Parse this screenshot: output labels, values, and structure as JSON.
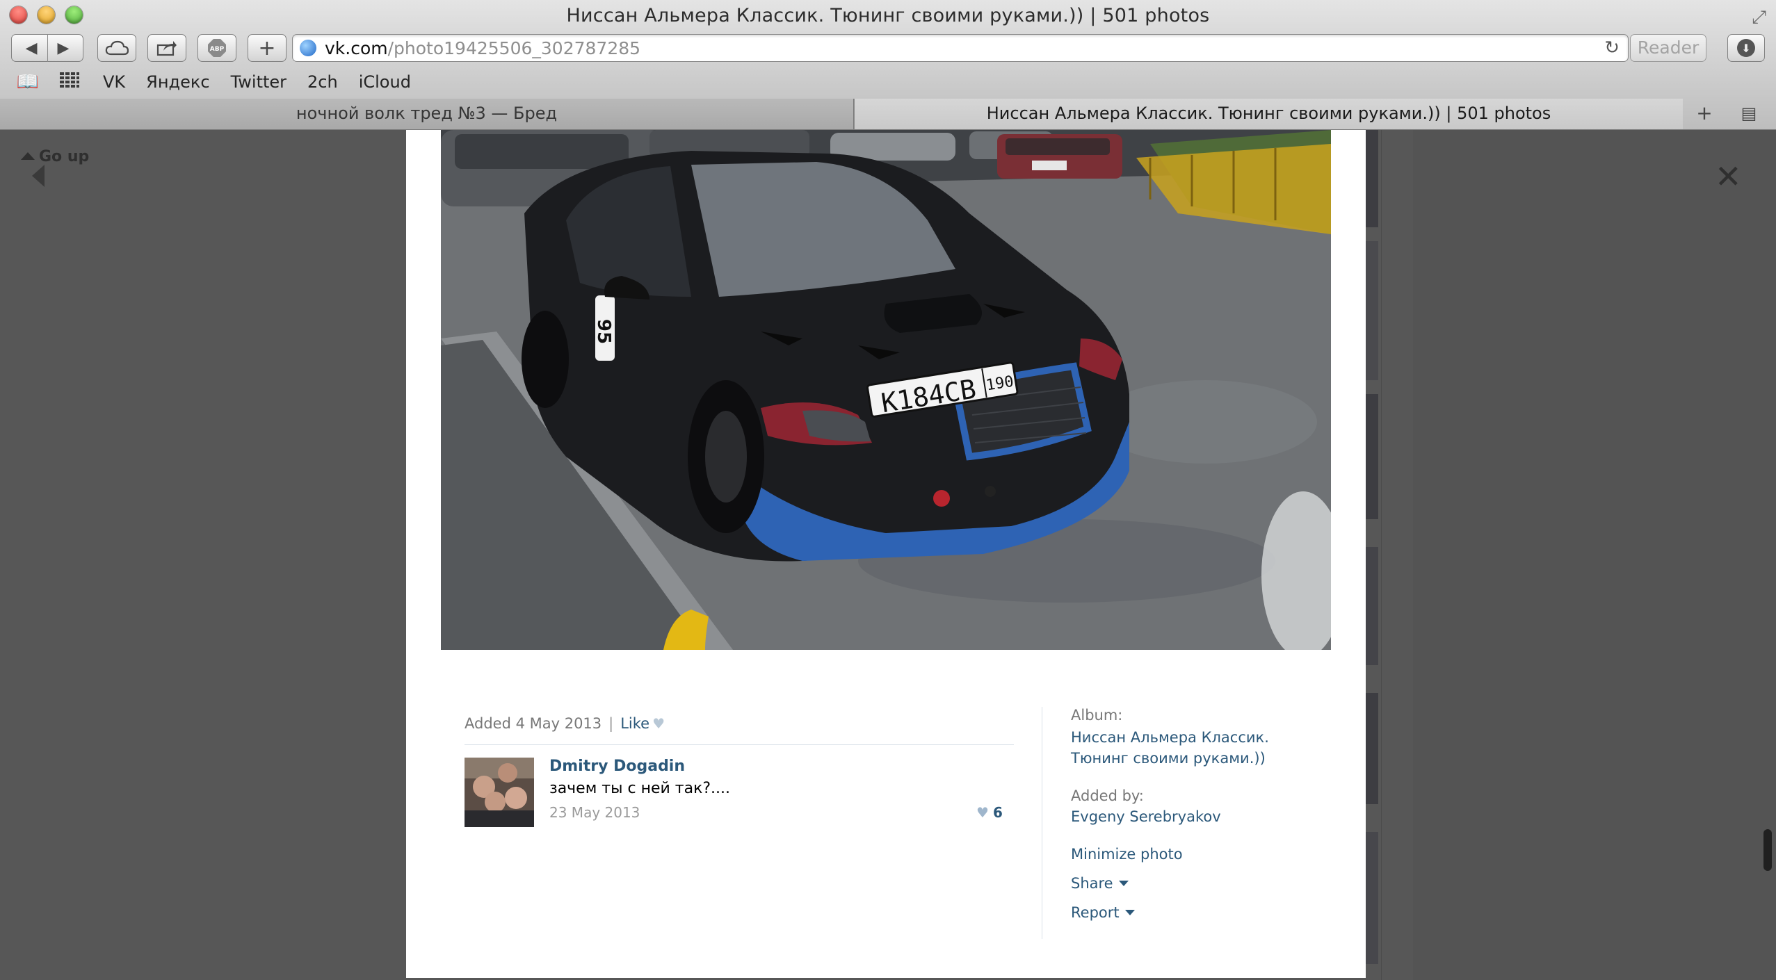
{
  "window": {
    "title": "Ниссан Альмера Классик. Тюнинг своими руками.)) | 501 photos"
  },
  "toolbar": {
    "url_host": "vk.com",
    "url_path": "/photo19425506_302787285",
    "reader_label": "Reader"
  },
  "bookmarks": [
    "VK",
    "Яндекс",
    "Twitter",
    "2ch",
    "iCloud"
  ],
  "tabs": [
    {
      "label": "ночной волк тред №3 — Бред",
      "active": false
    },
    {
      "label": "Ниссан Альмера Классик. Тюнинг своими руками.)) | 501 photos",
      "active": true
    }
  ],
  "viewer": {
    "go_up_label": "Go up",
    "photo": {
      "license_plate": "К184СВ",
      "plate_region": "190",
      "race_number": "95"
    },
    "meta": {
      "added": "Added 4 May 2013",
      "like_label": "Like"
    },
    "comment": {
      "author": "Dmitry Dogadin",
      "text": "зачем ты с ней так?....",
      "date": "23 May 2013",
      "likes": "6"
    },
    "sidebar": {
      "album_label": "Album:",
      "album_line1": "Ниссан Альмера Классик.",
      "album_line2": "Тюнинг своими руками.))",
      "added_by_label": "Added by:",
      "added_by": "Evgeny Serebryakov",
      "minimize": "Minimize photo",
      "share": "Share",
      "report": "Report"
    }
  },
  "colors": {
    "link": "#2b587a",
    "muted": "#777777",
    "overlay": "#575757",
    "car_accent_blue": "#2e63b4"
  }
}
